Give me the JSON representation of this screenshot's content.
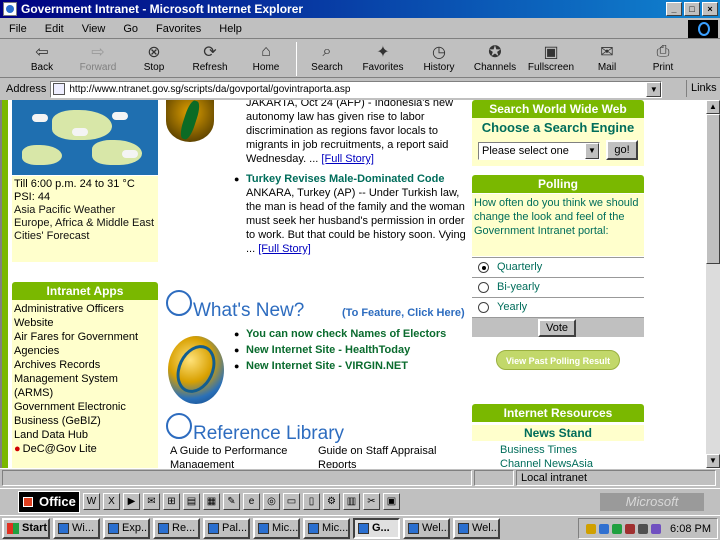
{
  "window": {
    "title": "Government Intranet - Microsoft Internet Explorer",
    "controls": [
      "_",
      "□",
      "×"
    ]
  },
  "menu": [
    "File",
    "Edit",
    "View",
    "Go",
    "Favorites",
    "Help"
  ],
  "toolbar": [
    {
      "label": "Back",
      "icon": "back-arrow-icon",
      "glyph": "⇦",
      "enabled": true
    },
    {
      "label": "Forward",
      "icon": "forward-arrow-icon",
      "glyph": "⇨",
      "enabled": false
    },
    {
      "label": "Stop",
      "icon": "stop-icon",
      "glyph": "⊗",
      "enabled": true
    },
    {
      "label": "Refresh",
      "icon": "refresh-icon",
      "glyph": "⟳",
      "enabled": true
    },
    {
      "label": "Home",
      "icon": "home-icon",
      "glyph": "⌂",
      "enabled": true
    },
    {
      "label": "Search",
      "icon": "search-icon",
      "glyph": "⌕",
      "enabled": true
    },
    {
      "label": "Favorites",
      "icon": "favorites-icon",
      "glyph": "✦",
      "enabled": true
    },
    {
      "label": "History",
      "icon": "history-icon",
      "glyph": "◷",
      "enabled": true
    },
    {
      "label": "Channels",
      "icon": "channels-icon",
      "glyph": "✪",
      "enabled": true
    },
    {
      "label": "Fullscreen",
      "icon": "fullscreen-icon",
      "glyph": "▣",
      "enabled": true
    },
    {
      "label": "Mail",
      "icon": "mail-icon",
      "glyph": "✉",
      "enabled": true
    },
    {
      "label": "Print",
      "icon": "print-icon",
      "glyph": "⎙",
      "enabled": true
    }
  ],
  "address": {
    "label": "Address",
    "url": "http://www.ntranet.gov.sg/scripts/da/govportal/govintraporta.asp",
    "links": "Links"
  },
  "weather": {
    "lines": [
      "Till 6:00 p.m. 24 to 31 °C",
      "PSI: 44"
    ],
    "links": [
      "Asia Pacific Weather",
      "Europe, Africa & Middle East Cities' Forecast"
    ]
  },
  "intranet_apps": {
    "title": "Intranet Apps",
    "items": [
      "Administrative Officers Website",
      "Air Fares for Government Agencies",
      "Archives Records Management System (ARMS)",
      "Government Electronic Business (GeBIZ)",
      "Land Data Hub",
      "DeC@Gov Lite"
    ]
  },
  "news": [
    {
      "headline": "",
      "body": "JAKARTA, Oct 24 (AFP) - Indonesia's new autonomy law has given rise to labor discrimination as regions favor locals to migrants in job recruitments, a report said Wednesday. ...",
      "more": "[Full Story]"
    },
    {
      "headline": "Turkey Revises Male-Dominated Code",
      "body": "ANKARA, Turkey (AP) -- Under Turkish law, the man is head of the family and the woman must seek her husband's permission in order to work. But that could be history soon. Vying ...",
      "more": "[Full Story]"
    }
  ],
  "whats_new": {
    "title": "What's New?",
    "feature_link": "(To Feature, Click Here)",
    "items": [
      "You can now check Names of Electors",
      "New Internet Site - HealthToday",
      "New Internet Site - VIRGIN.NET"
    ]
  },
  "reference_library": {
    "title": "Reference Library",
    "items": [
      "A Guide to Performance Management",
      "Guide on Staff Appraisal Reports"
    ]
  },
  "search_www": {
    "title": "Search World Wide Web",
    "subtitle": "Choose a Search Engine",
    "select_value": "Please select one",
    "go_label": "go!"
  },
  "polling": {
    "title": "Polling",
    "question": "How often do you think we should change the look and feel of the Government Intranet portal:",
    "options": [
      {
        "label": "Quarterly",
        "selected": true
      },
      {
        "label": "Bi-yearly",
        "selected": false
      },
      {
        "label": "Yearly",
        "selected": false
      }
    ],
    "vote_label": "Vote",
    "past_results_label": "View Past Polling Result"
  },
  "internet_resources": {
    "title": "Internet Resources",
    "subtitle": "News Stand",
    "items": [
      "Business Times",
      "Channel NewsAsia"
    ]
  },
  "status": {
    "text": "",
    "zone": "Local intranet"
  },
  "office_bar": {
    "label": "Office",
    "brand": "Microsoft"
  },
  "taskbar": {
    "start": "Start",
    "tasks": [
      "Wi...",
      "Exp...",
      "Re...",
      "Pal...",
      "Mic...",
      "Mic...",
      "G...",
      "Wel...",
      "Wel..."
    ],
    "active_index": 6,
    "clock": "6:08 PM"
  },
  "colors": {
    "title_bar": "#000080",
    "green_header": "#7ab800",
    "teal_text": "#006d5b",
    "cream_panel": "#ffffcc",
    "heading_blue": "#2d6cbf"
  }
}
